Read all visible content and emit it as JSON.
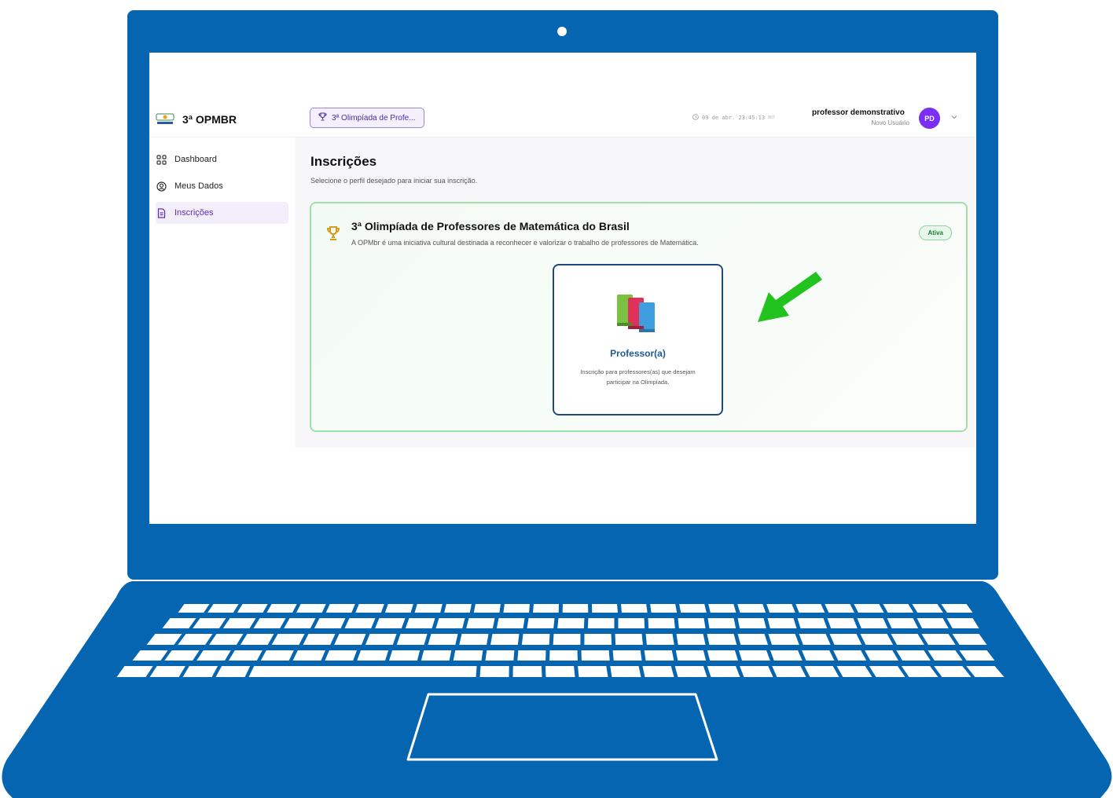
{
  "colors": {
    "laptop_body": "#0565b0",
    "arrow": "#22c21f",
    "accent": "#7a2ff2",
    "active_badge": "#1f7a33"
  },
  "brand": {
    "title": "3ª OPMBR",
    "logo_icon": "opmbr-logo"
  },
  "sidebar": {
    "items": [
      {
        "label": "Dashboard",
        "icon": "grid-icon",
        "active": false
      },
      {
        "label": "Meus Dados",
        "icon": "user-circle-icon",
        "active": false
      },
      {
        "label": "Inscrições",
        "icon": "document-icon",
        "active": true
      }
    ]
  },
  "topbar": {
    "event_selector": "3ª Olimpíada de Profe...",
    "datetime": "09 de abr. 23:45:13",
    "timezone": "BRT",
    "user_name": "professor demonstrativo",
    "user_role": "Novo Usuário",
    "avatar_initials": "PD"
  },
  "page": {
    "title": "Inscrições",
    "subtitle": "Selecione o perfil desejado para iniciar sua inscrição."
  },
  "event": {
    "title": "3ª Olimpíada de Professores de Matemática do Brasil",
    "description": "A OPMbr é uma iniciativa cultural destinada a reconhecer e valorizar o trabalho de professores de Matemática.",
    "status": "Ativa",
    "profile_card": {
      "title": "Professor(a)",
      "description": "Inscrição para professores(as) que desejam participar na Olimpíada.",
      "icon": "books-icon"
    }
  }
}
